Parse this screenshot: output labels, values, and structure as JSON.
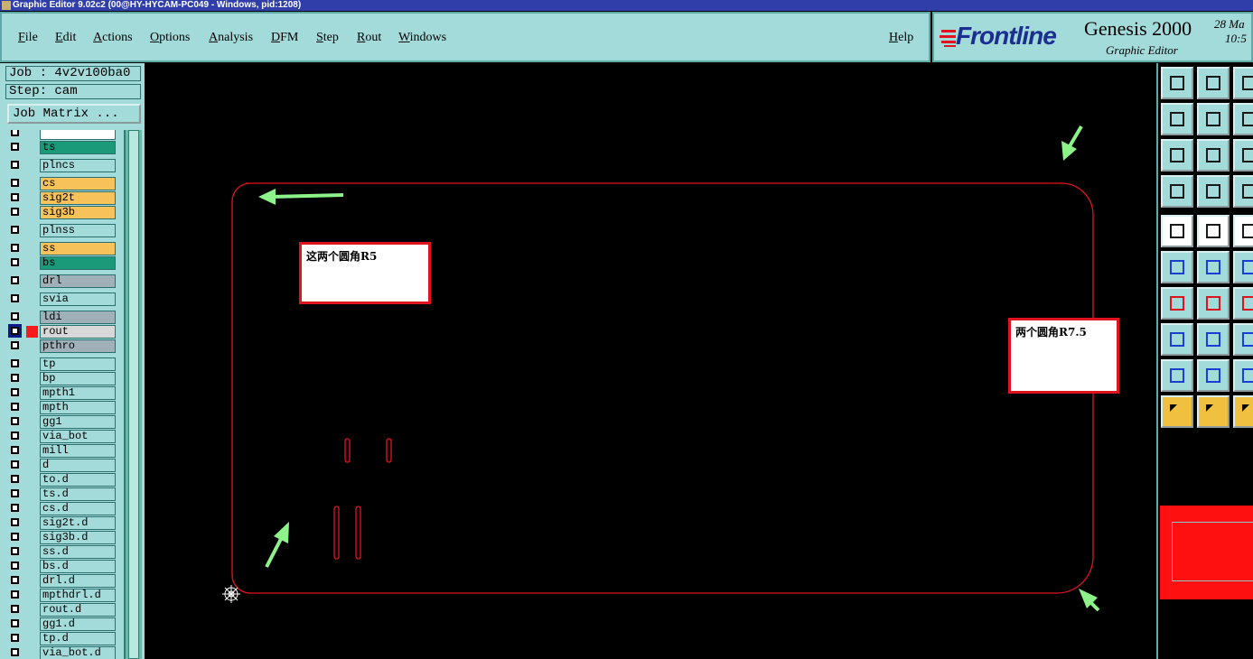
{
  "window": {
    "title": "Graphic Editor 9.02c2 (00@HY-HYCAM-PC049 - Windows, pid:1208)"
  },
  "menu": {
    "items": [
      "File",
      "Edit",
      "Actions",
      "Options",
      "Analysis",
      "DFM",
      "Step",
      "Rout",
      "Windows"
    ],
    "help": "Help"
  },
  "brand": {
    "logo": "Frontline",
    "product": "Genesis 2000",
    "subtitle": "Graphic Editor",
    "date": "28 Ma",
    "time": "10:5"
  },
  "job": {
    "job_label": "Job : 4v2v100ba0",
    "step_label": "Step: cam",
    "matrix_button": "Job Matrix ..."
  },
  "colors": {
    "panel": "#a3dada",
    "signal_green": "#1a9a78",
    "signal_orange": "#f7c25a",
    "drill_gray": "#a0b0b8",
    "outline_red": "#e0141e",
    "arrow_green": "#8ef28a"
  },
  "layers": [
    {
      "name": "",
      "color": "#ffffff"
    },
    {
      "name": "ts",
      "color": "#1a9a78"
    },
    {
      "name": "plncs",
      "color": "#a3dada"
    },
    {
      "name": "cs",
      "color": "#f7c25a"
    },
    {
      "name": "sig2t",
      "color": "#f7c25a"
    },
    {
      "name": "sig3b",
      "color": "#f7c25a"
    },
    {
      "name": "plnss",
      "color": "#a3dada"
    },
    {
      "name": "ss",
      "color": "#f7c25a"
    },
    {
      "name": "bs",
      "color": "#1a9a78"
    },
    {
      "name": "drl",
      "color": "#a0b0b8"
    },
    {
      "name": "svia",
      "color": "#a3dada"
    },
    {
      "name": "ldi",
      "color": "#a0b0b8"
    },
    {
      "name": "rout",
      "color": "#d8d8d8",
      "selected": true
    },
    {
      "name": "pthro",
      "color": "#a0b0b8"
    },
    {
      "name": "tp",
      "color": "#a3dada"
    },
    {
      "name": "bp",
      "color": "#a3dada"
    },
    {
      "name": "mpth1",
      "color": "#a3dada"
    },
    {
      "name": "mpth",
      "color": "#a3dada"
    },
    {
      "name": "gg1",
      "color": "#a3dada"
    },
    {
      "name": "via_bot",
      "color": "#a3dada"
    },
    {
      "name": "mill",
      "color": "#a3dada"
    },
    {
      "name": "d",
      "color": "#a3dada"
    },
    {
      "name": "to.d",
      "color": "#a3dada"
    },
    {
      "name": "ts.d",
      "color": "#a3dada"
    },
    {
      "name": "cs.d",
      "color": "#a3dada"
    },
    {
      "name": "sig2t.d",
      "color": "#a3dada"
    },
    {
      "name": "sig3b.d",
      "color": "#a3dada"
    },
    {
      "name": "ss.d",
      "color": "#a3dada"
    },
    {
      "name": "bs.d",
      "color": "#a3dada"
    },
    {
      "name": "drl.d",
      "color": "#a3dada"
    },
    {
      "name": "mpthdrl.d",
      "color": "#a3dada"
    },
    {
      "name": "rout.d",
      "color": "#a3dada"
    },
    {
      "name": "gg1.d",
      "color": "#a3dada"
    },
    {
      "name": "tp.d",
      "color": "#a3dada"
    },
    {
      "name": "via_bot.d",
      "color": "#a3dada"
    }
  ],
  "annotations": {
    "note_left": "这两个圆角R5",
    "note_right": "两个圆角R7.5"
  },
  "toolbar_icons": [
    "page-up-icon",
    "page-down-icon",
    "home-icon",
    "page-left-icon",
    "page-right-icon",
    "undo-zoom-icon",
    "zoom-fit-icon",
    "zoom-center-icon",
    "zoom-1to1-icon",
    "tools-palette-icon",
    "snap-point-icon",
    "layer-connect-icon",
    "add-pad-icon",
    "add-rect-icon",
    "ruler-icon",
    "connect-nodes-icon",
    "cross-icon",
    "arc-arrow-icon",
    "line-angle-icon",
    "line-draw-icon",
    "rotate-icon",
    "copy-pads-icon",
    "line-segment-icon",
    "measure-icon",
    "triangle-icon",
    "multi-triangle-icon",
    "triangle-line-icon",
    "select-arrow-icon",
    "select-box-icon",
    "select-circle-icon"
  ]
}
